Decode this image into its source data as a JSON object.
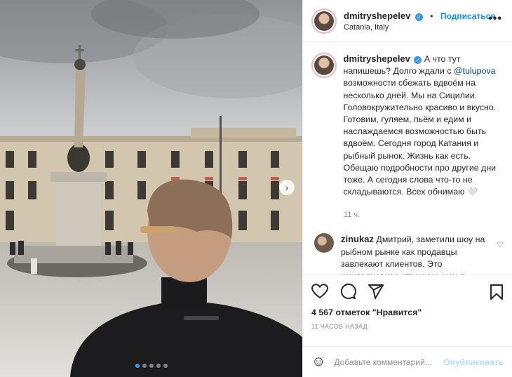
{
  "post": {
    "username": "dmitryshepelev",
    "verified_icon": "verified-badge-icon",
    "follow_label": "Подписаться",
    "separator": "•",
    "location": "Catania, Italy",
    "more_label": "•••"
  },
  "caption": {
    "username": "dmitryshepelev",
    "text_before_mention": "А что тут напишешь? Долго ждали с ",
    "mention": "@tulupova",
    "text_after_mention": " возможности сбежать вдвоём на несколько дней. Мы на Сицилии. Головокружительно красиво и вкусно. Готовим, гуляем, пьём и едим и наслаждаемся возможностью быть вдвоём. Сегодня город Катания и рыбный рынок. Жизнь как есть. Обещаю подробности про другие дни тоже. А сегодня слова что-то не складываются. Всех обнимаю 🤍",
    "time": "11 ч."
  },
  "comments": [
    {
      "username": "zinukaz",
      "text": "Дмитрий, заметили шоу на рыбном рынке как продавцы завлекают клиентов. Это каждодневное утренние шоу я"
    }
  ],
  "actions": {
    "likes": "4 567 отметок \"Нравится\"",
    "posted_ago": "11 ЧАСОВ НАЗАД"
  },
  "composer": {
    "placeholder": "Добавьте комментарий...",
    "publish_label": "Опубликовать",
    "emoji_icon": "smile-icon"
  },
  "carousel": {
    "slides": 5,
    "active_slide": 1,
    "next_label": "›"
  },
  "colors": {
    "accent": "#0095f6",
    "mention": "#00376b",
    "muted": "#8e8e8e",
    "publish_disabled": "#b2dffc"
  }
}
